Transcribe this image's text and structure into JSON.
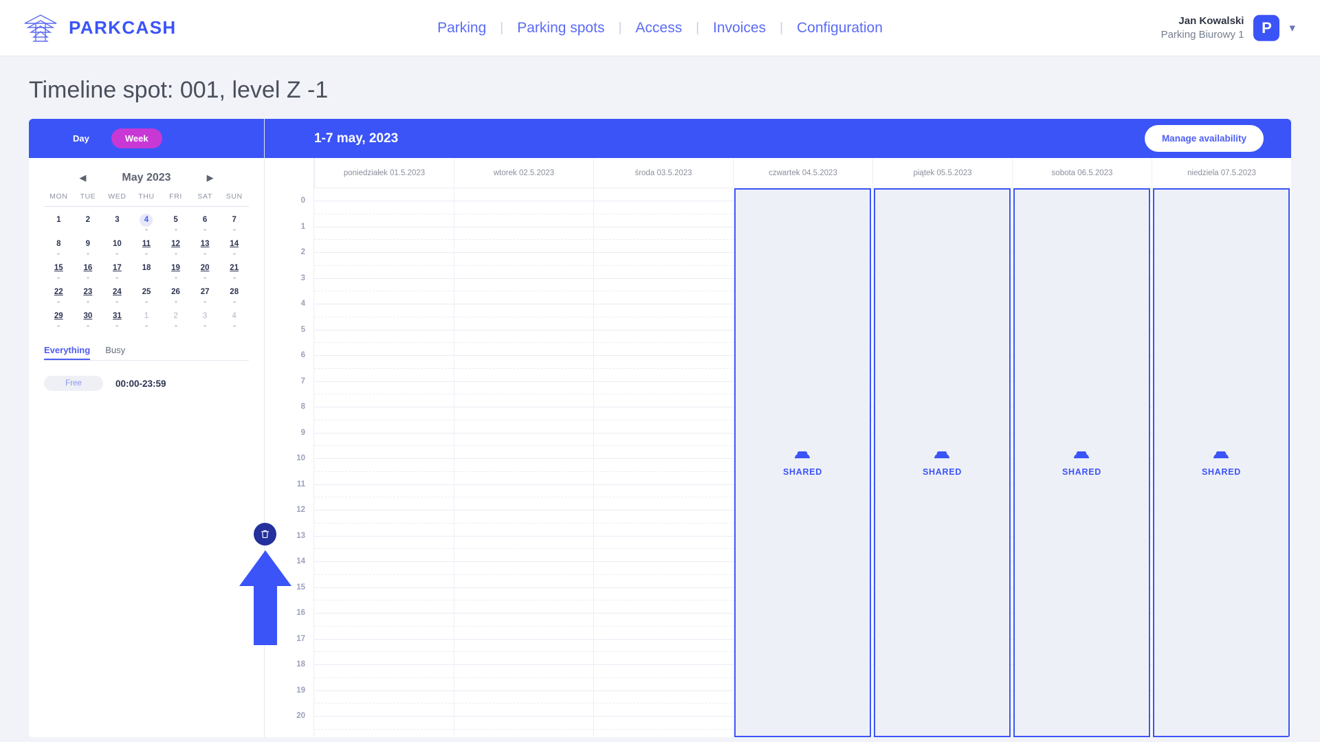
{
  "brand": {
    "name": "PARKCASH",
    "icon": "parkcash-logo-icon",
    "color": "#3b54f7"
  },
  "nav": {
    "items": [
      {
        "label": "Parking"
      },
      {
        "label": "Parking spots"
      },
      {
        "label": "Access"
      },
      {
        "label": "Invoices"
      },
      {
        "label": "Configuration"
      }
    ],
    "separator": "|"
  },
  "user": {
    "name": "Jan Kowalski",
    "parking": "Parking Biurowy 1",
    "avatar_letter": "P",
    "chevron": "chevron-down-icon"
  },
  "page": {
    "title": "Timeline spot: 001, level Z -1"
  },
  "sidebar": {
    "view_toggle": {
      "day": "Day",
      "week": "Week",
      "active": "Week",
      "active_color": "#c838d4"
    },
    "calendar": {
      "title": "May 2023",
      "prev_icon": "prev-month-icon",
      "next_icon": "next-month-icon",
      "dow": [
        "MON",
        "TUE",
        "WED",
        "THU",
        "FRI",
        "SAT",
        "SUN"
      ],
      "days": [
        {
          "n": "1",
          "muted": false,
          "underline": false,
          "selected": false,
          "dot": false
        },
        {
          "n": "2",
          "muted": false,
          "underline": false,
          "selected": false,
          "dot": false
        },
        {
          "n": "3",
          "muted": false,
          "underline": false,
          "selected": false,
          "dot": false
        },
        {
          "n": "4",
          "muted": false,
          "underline": false,
          "selected": true,
          "dot": true
        },
        {
          "n": "5",
          "muted": false,
          "underline": false,
          "selected": false,
          "dot": true
        },
        {
          "n": "6",
          "muted": false,
          "underline": false,
          "selected": false,
          "dot": true
        },
        {
          "n": "7",
          "muted": false,
          "underline": false,
          "selected": false,
          "dot": true
        },
        {
          "n": "8",
          "muted": false,
          "underline": false,
          "selected": false,
          "dot": true
        },
        {
          "n": "9",
          "muted": false,
          "underline": false,
          "selected": false,
          "dot": true
        },
        {
          "n": "10",
          "muted": false,
          "underline": false,
          "selected": false,
          "dot": true
        },
        {
          "n": "11",
          "muted": false,
          "underline": true,
          "selected": false,
          "dot": true
        },
        {
          "n": "12",
          "muted": false,
          "underline": true,
          "selected": false,
          "dot": true
        },
        {
          "n": "13",
          "muted": false,
          "underline": true,
          "selected": false,
          "dot": true
        },
        {
          "n": "14",
          "muted": false,
          "underline": true,
          "selected": false,
          "dot": true
        },
        {
          "n": "15",
          "muted": false,
          "underline": true,
          "selected": false,
          "dot": true
        },
        {
          "n": "16",
          "muted": false,
          "underline": true,
          "selected": false,
          "dot": true
        },
        {
          "n": "17",
          "muted": false,
          "underline": true,
          "selected": false,
          "dot": true
        },
        {
          "n": "18",
          "muted": false,
          "underline": false,
          "selected": false,
          "dot": false
        },
        {
          "n": "19",
          "muted": false,
          "underline": true,
          "selected": false,
          "dot": true
        },
        {
          "n": "20",
          "muted": false,
          "underline": true,
          "selected": false,
          "dot": true
        },
        {
          "n": "21",
          "muted": false,
          "underline": true,
          "selected": false,
          "dot": true
        },
        {
          "n": "22",
          "muted": false,
          "underline": true,
          "selected": false,
          "dot": true
        },
        {
          "n": "23",
          "muted": false,
          "underline": true,
          "selected": false,
          "dot": true
        },
        {
          "n": "24",
          "muted": false,
          "underline": true,
          "selected": false,
          "dot": true
        },
        {
          "n": "25",
          "muted": false,
          "underline": false,
          "selected": false,
          "dot": true
        },
        {
          "n": "26",
          "muted": false,
          "underline": false,
          "selected": false,
          "dot": true
        },
        {
          "n": "27",
          "muted": false,
          "underline": false,
          "selected": false,
          "dot": true
        },
        {
          "n": "28",
          "muted": false,
          "underline": false,
          "selected": false,
          "dot": true
        },
        {
          "n": "29",
          "muted": false,
          "underline": true,
          "selected": false,
          "dot": true
        },
        {
          "n": "30",
          "muted": false,
          "underline": true,
          "selected": false,
          "dot": true
        },
        {
          "n": "31",
          "muted": false,
          "underline": true,
          "selected": false,
          "dot": true
        },
        {
          "n": "1",
          "muted": true,
          "underline": false,
          "selected": false,
          "dot": true
        },
        {
          "n": "2",
          "muted": true,
          "underline": false,
          "selected": false,
          "dot": true
        },
        {
          "n": "3",
          "muted": true,
          "underline": false,
          "selected": false,
          "dot": true
        },
        {
          "n": "4",
          "muted": true,
          "underline": false,
          "selected": false,
          "dot": true
        }
      ]
    },
    "tabs": [
      {
        "label": "Everything",
        "active": true
      },
      {
        "label": "Busy",
        "active": false
      }
    ],
    "availability": {
      "status_label": "Free",
      "time_range": "00:00-23:59",
      "delete_icon": "trash-icon"
    },
    "annotation": {
      "icon": "up-arrow-annotation",
      "color": "#3b54f7"
    }
  },
  "timeline": {
    "range_label": "1-7 may, 2023",
    "manage_button": "Manage availability",
    "day_columns": [
      {
        "label": "poniedziałek 01.5.2023",
        "shared": false
      },
      {
        "label": "wtorek 02.5.2023",
        "shared": false
      },
      {
        "label": "środa 03.5.2023",
        "shared": false
      },
      {
        "label": "czwartek 04.5.2023",
        "shared": true
      },
      {
        "label": "piątek 05.5.2023",
        "shared": true
      },
      {
        "label": "sobota 06.5.2023",
        "shared": true
      },
      {
        "label": "niedziela 07.5.2023",
        "shared": true
      }
    ],
    "hours": [
      "0",
      "1",
      "2",
      "3",
      "4",
      "5",
      "6",
      "7",
      "8",
      "9",
      "10",
      "11",
      "12",
      "13",
      "14",
      "15",
      "16",
      "17",
      "18",
      "19",
      "20"
    ],
    "shared_label": "SHARED",
    "shared_icon": "car-icon",
    "accent_color": "#3b54f7"
  }
}
